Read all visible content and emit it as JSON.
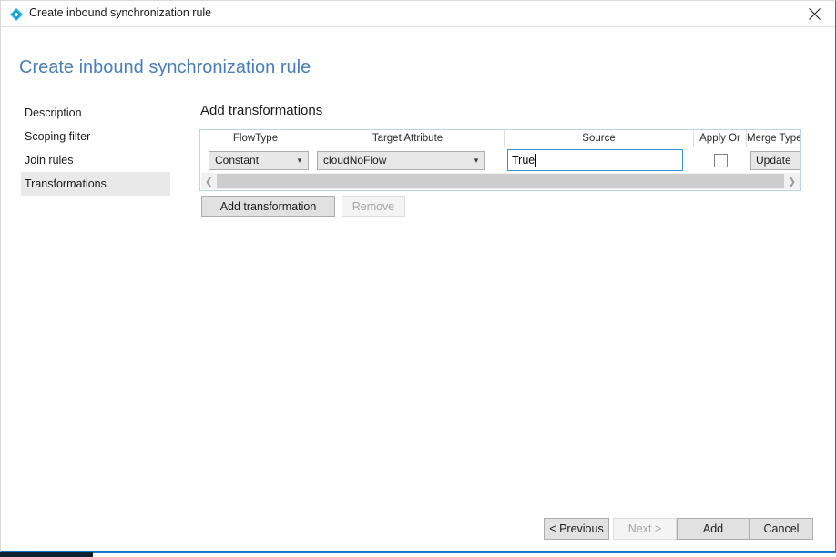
{
  "window": {
    "title": "Create inbound synchronization rule",
    "title_icon": "sync-rule-diamond-icon",
    "close_icon": "close-icon",
    "accent_color": "#1a74bd"
  },
  "page": {
    "heading": "Create inbound synchronization rule",
    "heading_color": "#4a7ebb"
  },
  "sidebar": {
    "items": [
      {
        "label": "Description",
        "selected": false
      },
      {
        "label": "Scoping filter",
        "selected": false
      },
      {
        "label": "Join rules",
        "selected": false
      },
      {
        "label": "Transformations",
        "selected": true
      }
    ],
    "selected_background": "#e9e9e9"
  },
  "main": {
    "section_title": "Add transformations",
    "grid": {
      "columns": [
        "FlowType",
        "Target Attribute",
        "Source",
        "Apply Or",
        "Merge Type"
      ],
      "rows": [
        {
          "flow_type": "Constant",
          "target_attribute": "cloudNoFlow",
          "source": "True",
          "apply_once": false,
          "merge_type": "Update"
        }
      ],
      "source_focused": true,
      "focus_border_color": "#3f8ddb",
      "scrollbar": {
        "left_arrow": "chevron-left-icon",
        "right_arrow": "chevron-right-icon",
        "thumb_width_percent": 100
      }
    },
    "buttons": {
      "add_transformation": {
        "label": "Add transformation",
        "enabled": true
      },
      "remove": {
        "label": "Remove",
        "enabled": false
      }
    }
  },
  "footer": {
    "buttons": [
      {
        "label": "< Previous",
        "enabled": true
      },
      {
        "label": "Next >",
        "enabled": false
      },
      {
        "label": "Add",
        "enabled": true
      },
      {
        "label": "Cancel",
        "enabled": true
      }
    ]
  }
}
